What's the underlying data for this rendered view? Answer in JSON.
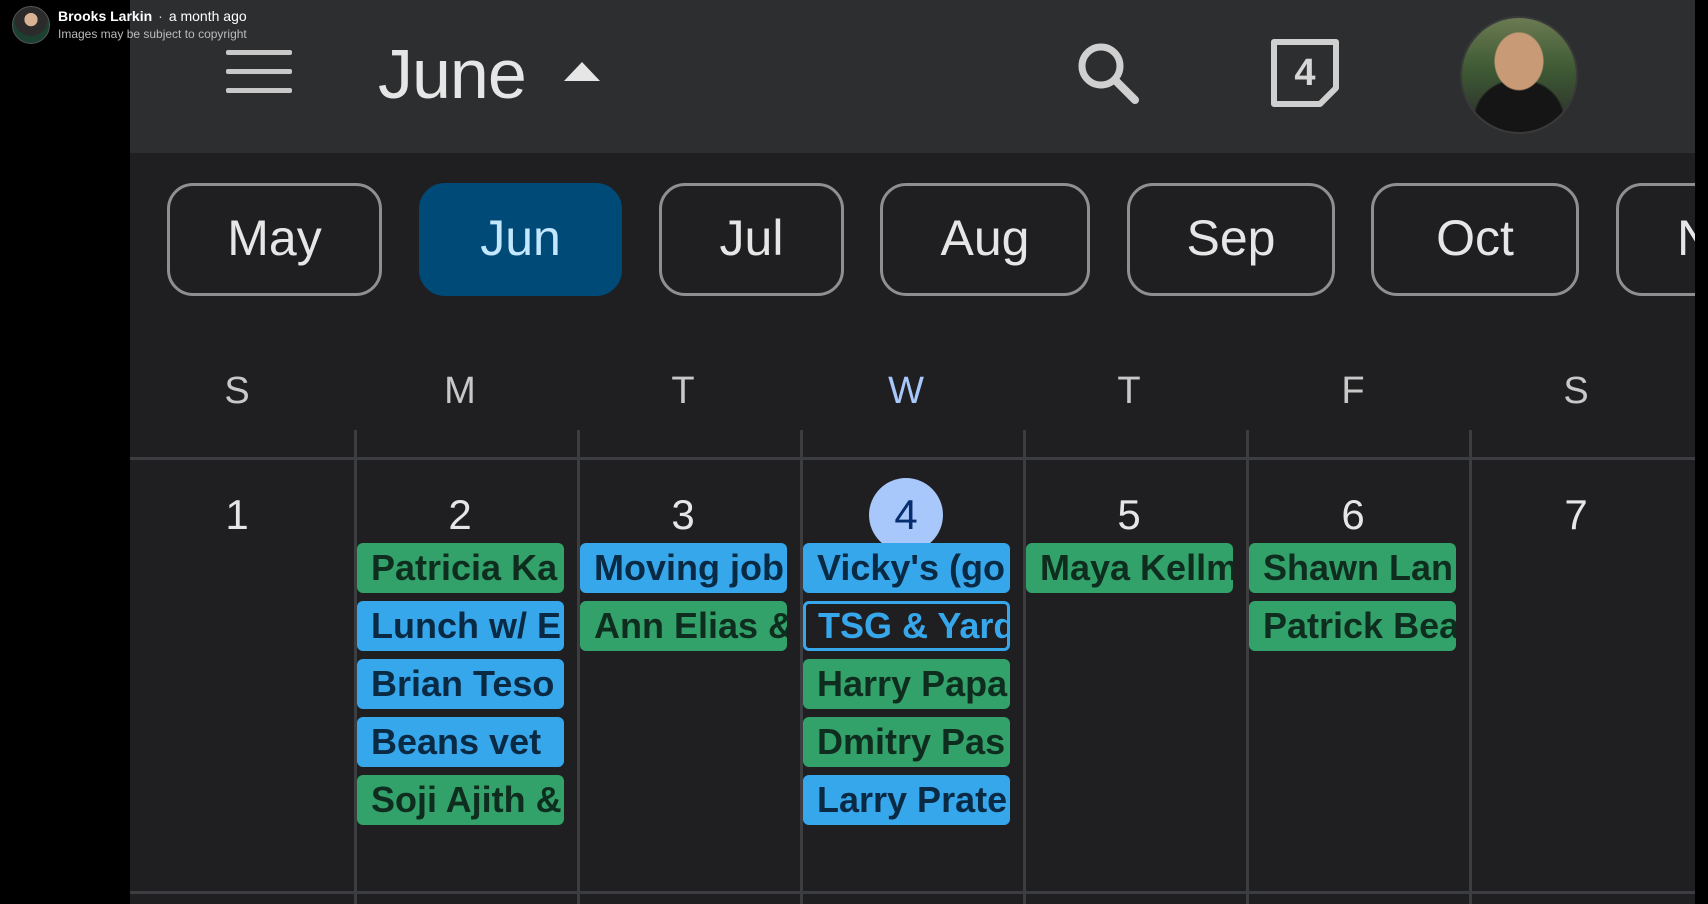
{
  "overlay": {
    "author": "Brooks Larkin",
    "separator": "·",
    "time_ago": "a month ago",
    "notice": "Images may be subject to copyright"
  },
  "header": {
    "month_title": "June",
    "today_date": "4",
    "icons": [
      "menu-icon",
      "caret-up-icon",
      "search-icon",
      "today-calendar-icon",
      "profile-avatar"
    ]
  },
  "month_chips": [
    {
      "label": "May",
      "active": false
    },
    {
      "label": "Jun",
      "active": true
    },
    {
      "label": "Jul",
      "active": false
    },
    {
      "label": "Aug",
      "active": false
    },
    {
      "label": "Sep",
      "active": false
    },
    {
      "label": "Oct",
      "active": false
    },
    {
      "label": "N",
      "active": false
    }
  ],
  "weekdays": [
    "S",
    "M",
    "T",
    "W",
    "T",
    "F",
    "S"
  ],
  "today_index": 3,
  "days": [
    {
      "date": "1",
      "events": []
    },
    {
      "date": "2",
      "events": [
        {
          "title": "Patricia Ka",
          "color": "green"
        },
        {
          "title": "Lunch w/ E",
          "color": "blue"
        },
        {
          "title": "Brian Teso",
          "color": "blue"
        },
        {
          "title": "Beans vet",
          "color": "blue"
        },
        {
          "title": "Soji Ajith &",
          "color": "green"
        }
      ]
    },
    {
      "date": "3",
      "events": [
        {
          "title": "Moving job",
          "color": "blue"
        },
        {
          "title": "Ann Elias &",
          "color": "green"
        }
      ]
    },
    {
      "date": "4",
      "events": [
        {
          "title": "Vicky's (go",
          "color": "blue"
        },
        {
          "title": "TSG & Yard",
          "color": "outline"
        },
        {
          "title": "Harry Papa",
          "color": "green"
        },
        {
          "title": "Dmitry Pas",
          "color": "green"
        },
        {
          "title": "Larry Prate",
          "color": "blue"
        }
      ]
    },
    {
      "date": "5",
      "events": [
        {
          "title": "Maya Kellm",
          "color": "green"
        }
      ]
    },
    {
      "date": "6",
      "events": [
        {
          "title": "Shawn Lan",
          "color": "green"
        },
        {
          "title": "Patrick Bea",
          "color": "green"
        }
      ]
    },
    {
      "date": "7",
      "events": []
    }
  ],
  "colors": {
    "green": "#33a16a",
    "blue": "#37a7ec",
    "today_circle": "#a8c7fa",
    "active_chip": "#004a77"
  }
}
